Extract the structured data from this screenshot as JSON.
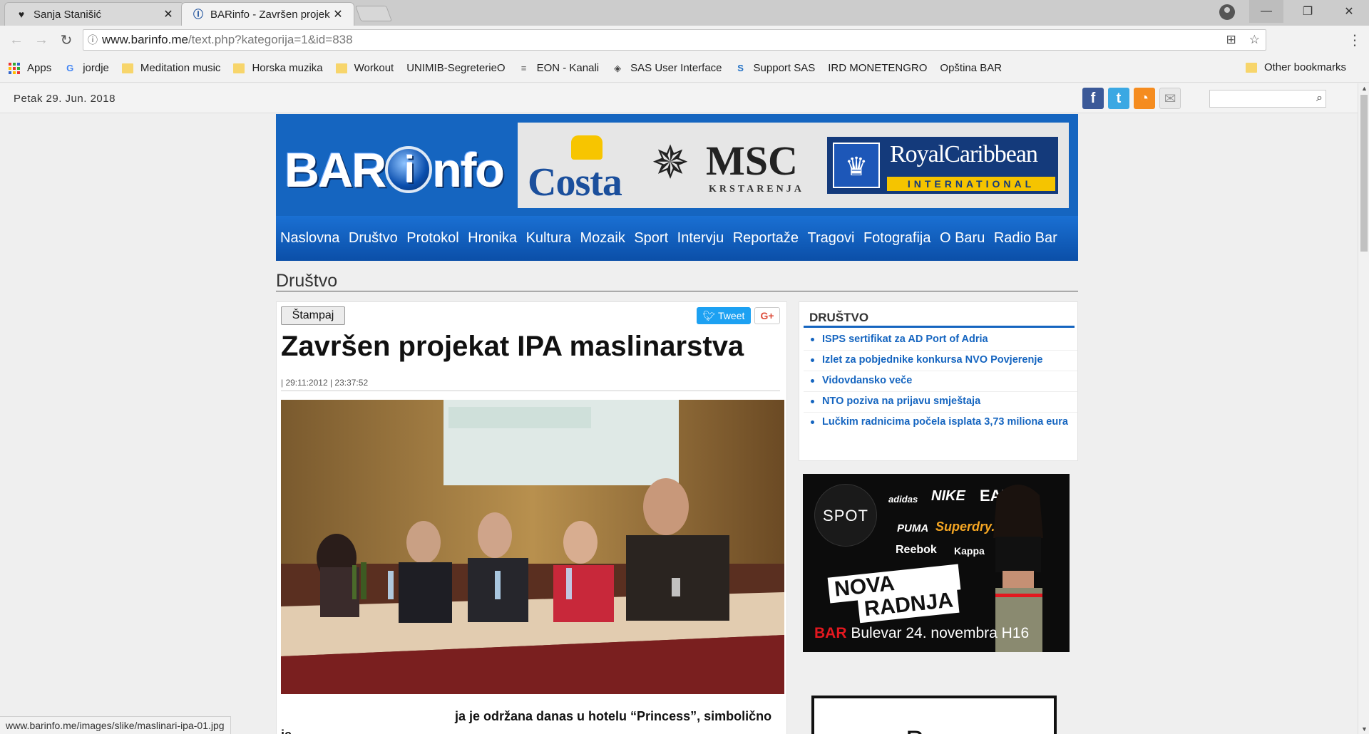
{
  "browser": {
    "tabs": [
      {
        "title": "Sanja Stanišić",
        "icon": "heart-icon"
      },
      {
        "title": "BARinfo - Završen projek",
        "icon": "barinfo-favicon"
      }
    ],
    "url_host": "www.barinfo.me",
    "url_path": "/text.php?kategorija=1&id=838",
    "status_url": "www.barinfo.me/images/slike/maslinari-ipa-01.jpg"
  },
  "bookmarks": {
    "items": [
      {
        "label": "Apps",
        "icon": "apps-grid-icon"
      },
      {
        "label": "jordje",
        "icon": "google-icon"
      },
      {
        "label": "Meditation music",
        "icon": "folder-icon"
      },
      {
        "label": "Horska muzika",
        "icon": "folder-icon"
      },
      {
        "label": "Workout",
        "icon": "folder-icon"
      },
      {
        "label": "UNIMIB-SegreterieO",
        "icon": "page-icon"
      },
      {
        "label": "EON - Kanali",
        "icon": "eon-icon"
      },
      {
        "label": "SAS User Interface",
        "icon": "sas-icon"
      },
      {
        "label": "Support SAS",
        "icon": "sas-s-icon"
      },
      {
        "label": "IRD MONETENGRO",
        "icon": "page-icon"
      },
      {
        "label": "Opština BAR",
        "icon": "page-icon"
      }
    ],
    "other": "Other bookmarks"
  },
  "site": {
    "date": "Petak 29. Jun. 2018",
    "logo": "BARinfo",
    "ads": {
      "costa": "Costa",
      "msc": "MSC",
      "msc_sub": "KRSTARENJA",
      "rc": "RoyalCaribbean",
      "rc_sub": "INTERNATIONAL"
    },
    "nav": [
      "Naslovna",
      "Društvo",
      "Protokol",
      "Hronika",
      "Kultura",
      "Mozaik",
      "Sport",
      "Intervju",
      "Reportaže",
      "Tragovi",
      "Fotografija",
      "O Baru",
      "Radio Bar"
    ],
    "section": "Društvo"
  },
  "article": {
    "print_label": "Štampaj",
    "tweet_label": "Tweet",
    "gplus_label": "G+",
    "title": "Završen projekat IPA maslinarstva",
    "date": "| 29:11:2012 | 23:37:52",
    "body_visible": "ja je održana danas u hotelu “Princess”, simbolično je"
  },
  "sidebar": {
    "title": "DRUŠTVO",
    "items": [
      "ISPS sertifikat za AD Port of Adria",
      "Izlet za pobjednike konkursa NVO Povjerenje",
      "Vidovdansko veče",
      "NTO poziva na prijavu smještaja",
      "Lučkim radnicima počela isplata 3,73 miliona eura"
    ],
    "spot_ad": {
      "logo": "SPOT",
      "brands": [
        "adidas",
        "NIKE",
        "EA7",
        "PUMA",
        "Superdry.",
        "Reebok",
        "Kappa"
      ],
      "line1": "NOVA",
      "line2": "RADNJA",
      "city": "BAR",
      "address": "Bulevar 24. novembra H16"
    },
    "bar_ad_text": "Bar"
  }
}
